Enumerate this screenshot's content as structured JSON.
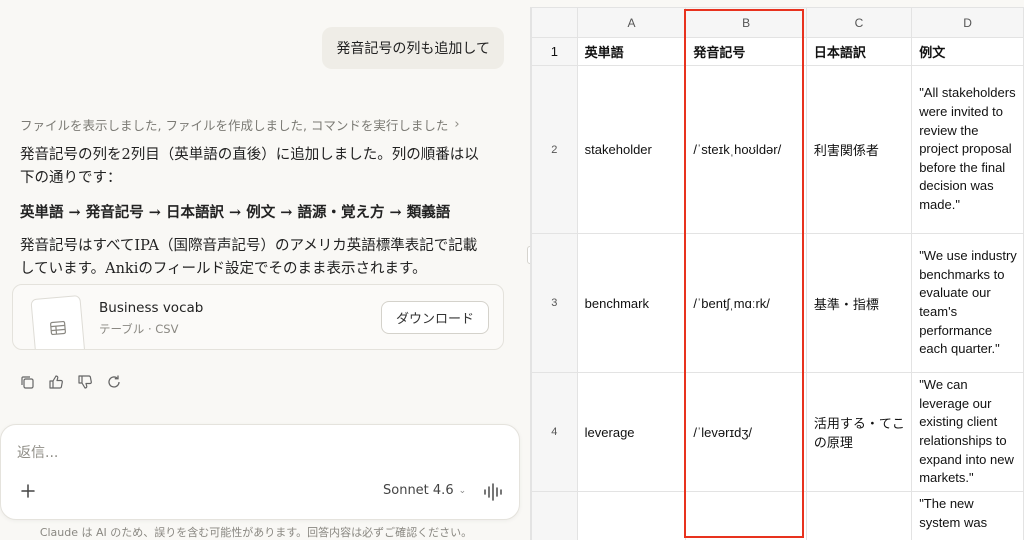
{
  "chat": {
    "user_message": "発音記号の列も追加して",
    "actions_summary": "ファイルを表示しました, ファイルを作成しました, コマンドを実行しました",
    "reply_paragraph_1": "発音記号の列を2列目（英単語の直後）に追加しました。列の順番は以下の通りです：",
    "reply_order": "英単語 → 発音記号 → 日本語訳 → 例文 → 語源・覚え方 → 類義語",
    "reply_paragraph_2": "発音記号はすべてIPA（国際音声記号）のアメリカ英語標準表記で記載しています。Ankiのフィールド設定でそのまま表示されます。",
    "file": {
      "title": "Business vocab",
      "subtitle": "テーブル · CSV",
      "download_label": "ダウンロード"
    },
    "composer": {
      "placeholder": "返信...",
      "model": "Sonnet 4.6"
    },
    "disclaimer": "Claude は AI のため、誤りを含む可能性があります。回答内容は必ずご確認ください。"
  },
  "sheet": {
    "columns": [
      "A",
      "B",
      "C",
      "D"
    ],
    "header_row_number": "1",
    "headers": [
      "英単語",
      "発音記号",
      "日本語訳",
      "例文"
    ],
    "rows": [
      {
        "num": "2",
        "word": "stakeholder",
        "ipa": "/ˈsteɪkˌhoʊldər/",
        "ja": "利害関係者",
        "example": "\"All stakeholders were invited to review the project proposal before the final decision was made.\""
      },
      {
        "num": "3",
        "word": "benchmark",
        "ipa": "/ˈbentʃˌmɑːrk/",
        "ja": "基準・指標",
        "example": "\"We use industry benchmarks to evaluate our team's performance each quarter.\""
      },
      {
        "num": "4",
        "word": "leverage",
        "ipa": "/ˈlevərɪdʒ/",
        "ja": "活用する・てこの原理",
        "example": "\"We can leverage our existing client relationships to expand into new markets.\""
      },
      {
        "num": "",
        "word": "",
        "ipa": "",
        "ja": "",
        "example": "\"The new system was"
      }
    ]
  },
  "colors": {
    "highlight": "#e8321e",
    "chat_background": "#f9f8f5",
    "header_background": "#f6f6f6"
  }
}
